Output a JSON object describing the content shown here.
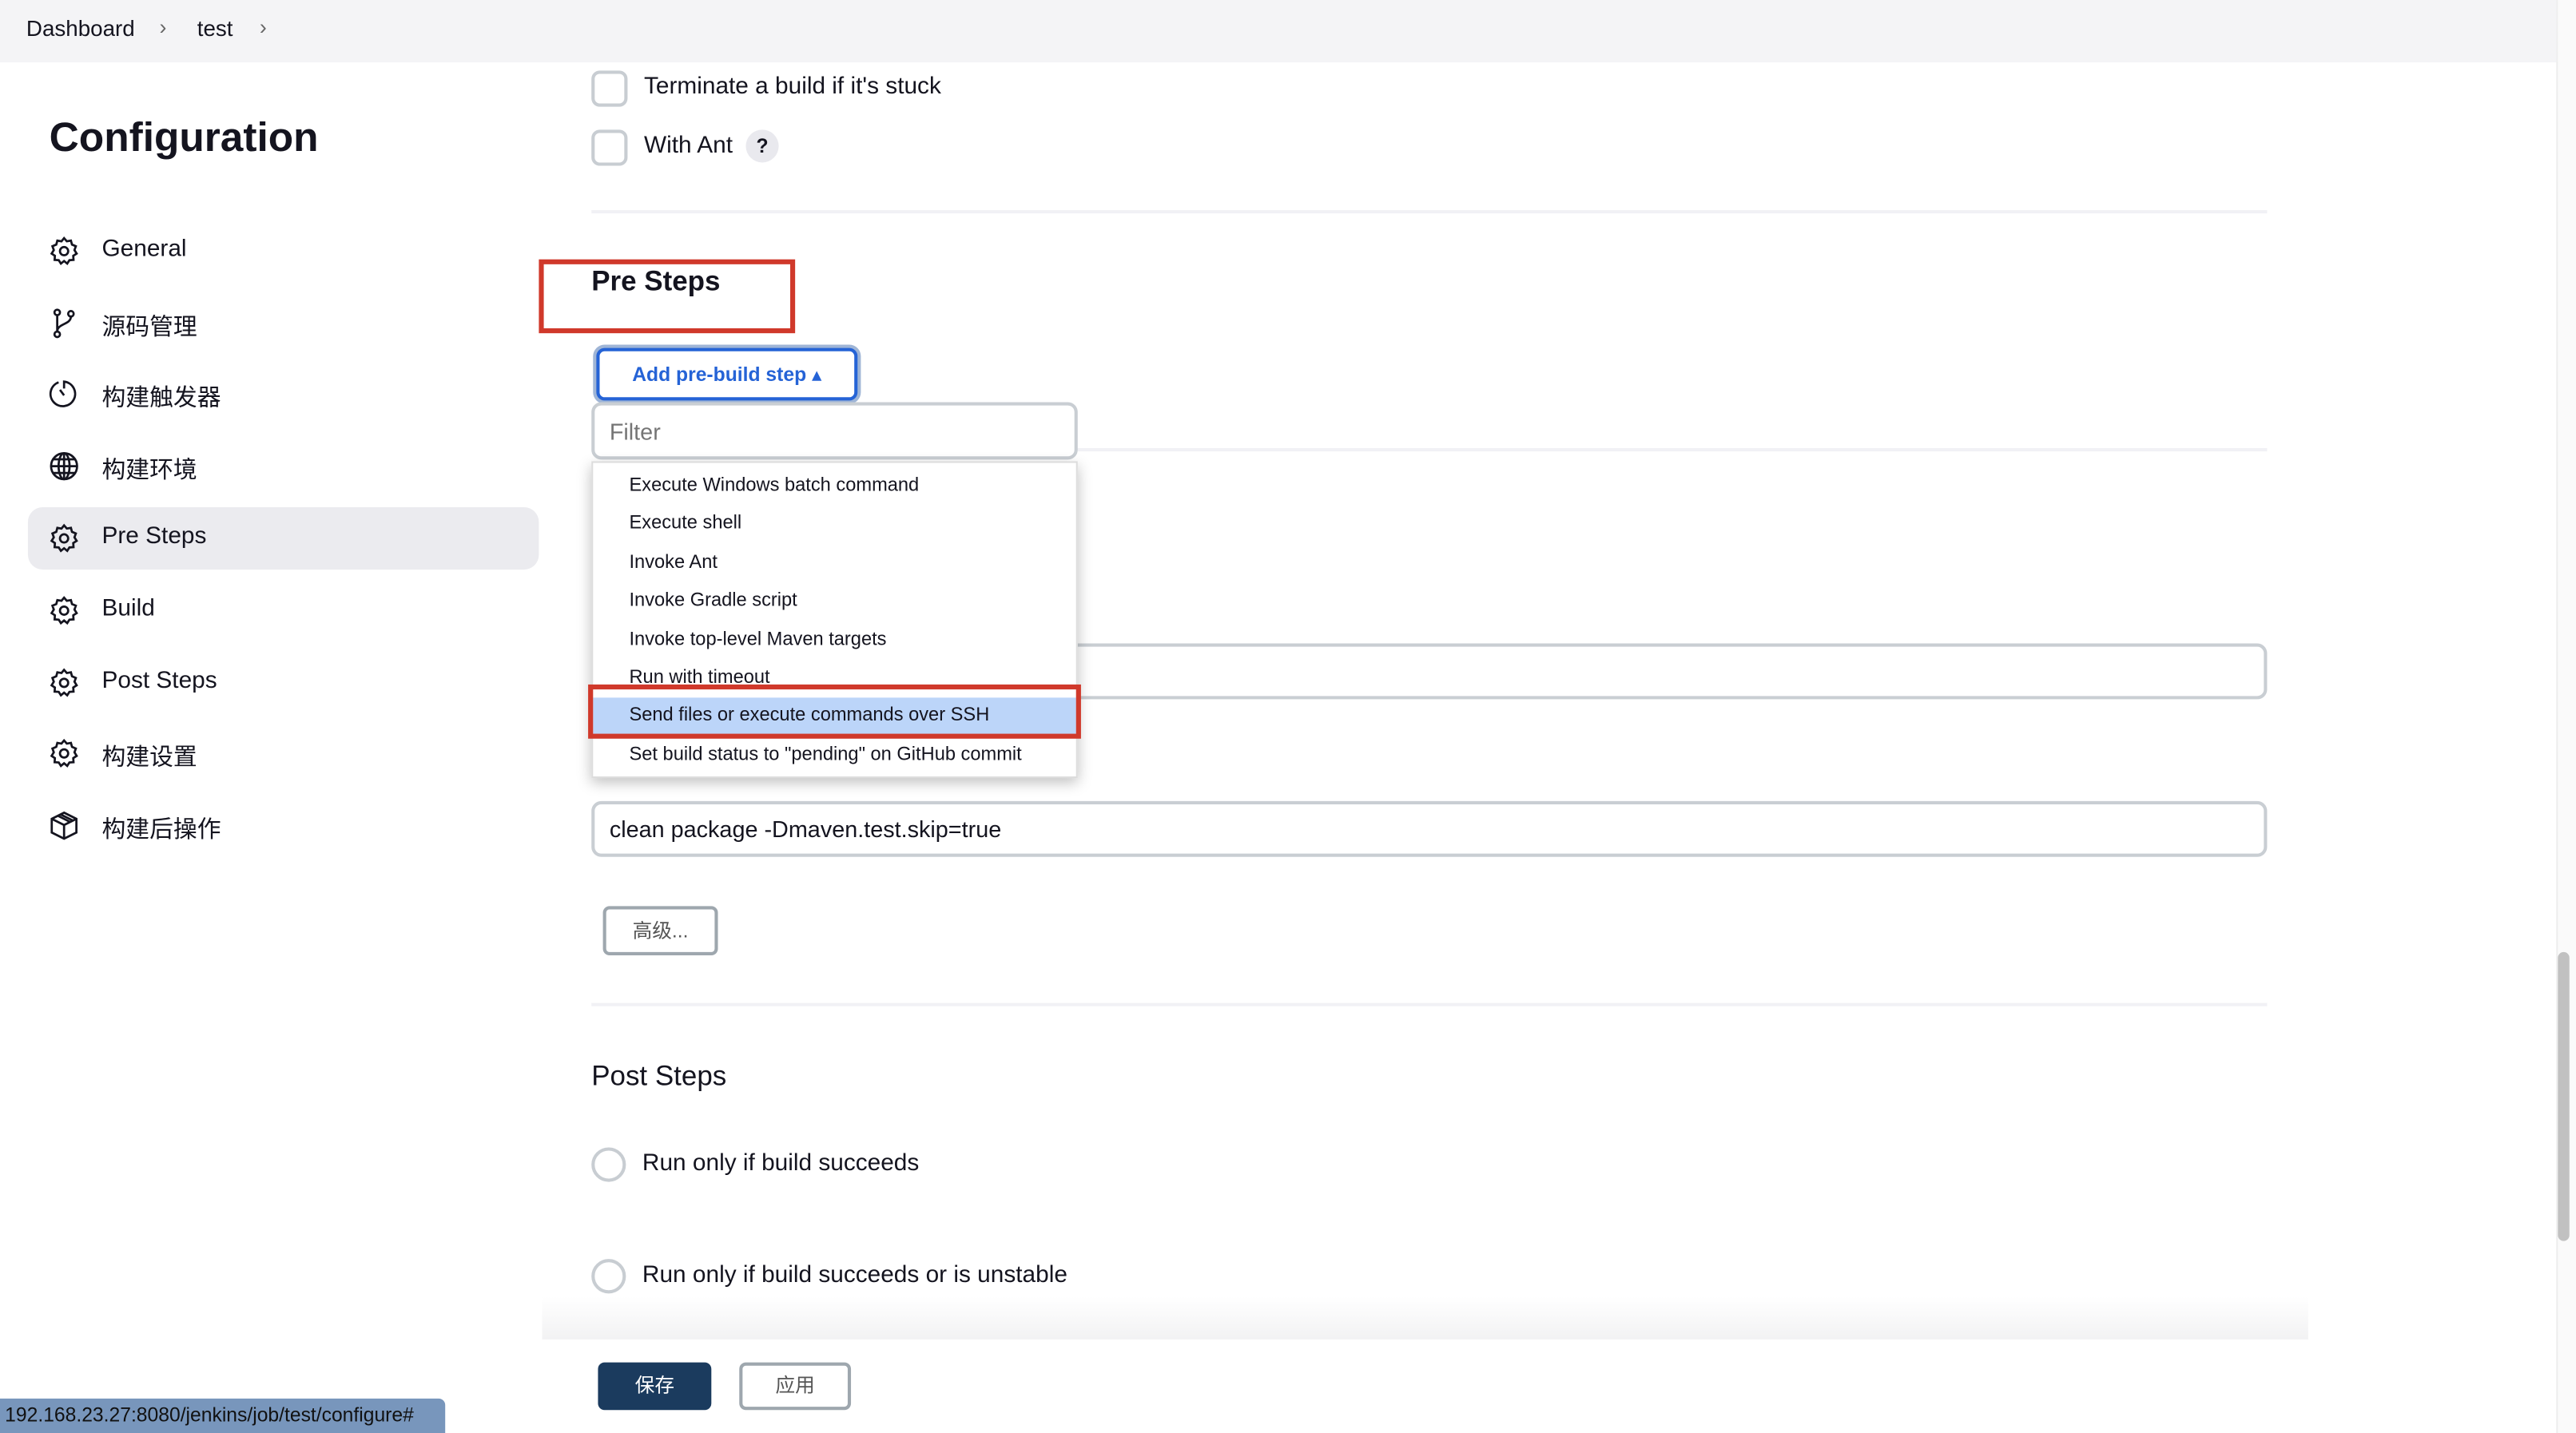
{
  "breadcrumb": {
    "items": [
      "Dashboard",
      "test"
    ]
  },
  "sidebar": {
    "title": "Configuration",
    "items": [
      {
        "label": "General",
        "icon": "gear-icon"
      },
      {
        "label": "源码管理",
        "icon": "branch-icon"
      },
      {
        "label": "构建触发器",
        "icon": "clock-icon"
      },
      {
        "label": "构建环境",
        "icon": "globe-icon"
      },
      {
        "label": "Pre Steps",
        "icon": "gear-icon",
        "active": true
      },
      {
        "label": "Build",
        "icon": "gear-icon"
      },
      {
        "label": "Post Steps",
        "icon": "gear-icon"
      },
      {
        "label": "构建设置",
        "icon": "gear-icon"
      },
      {
        "label": "构建后操作",
        "icon": "package-icon"
      }
    ]
  },
  "main": {
    "options": [
      {
        "label": "Terminate a build if it's stuck",
        "checked": false
      },
      {
        "label": "With Ant",
        "checked": false,
        "help": "?"
      }
    ],
    "pre_steps": {
      "title": "Pre Steps",
      "add_button": "Add pre-build step ▴",
      "filter_placeholder": "Filter",
      "menu_items": [
        "Execute Windows batch command",
        "Execute shell",
        "Invoke Ant",
        "Invoke Gradle script",
        "Invoke top-level Maven targets",
        "Run with timeout",
        "Send files or execute commands over SSH",
        "Set build status to \"pending\" on GitHub commit"
      ],
      "highlighted_item": "Send files or execute commands over SSH"
    },
    "goals_value": "clean package -Dmaven.test.skip=true",
    "advanced_button": "高级...",
    "post_steps": {
      "title": "Post Steps",
      "radios": [
        "Run only if build succeeds",
        "Run only if build succeeds or is unstable"
      ]
    },
    "save_button": "保存",
    "apply_button": "应用"
  },
  "status_url": "192.168.23.27:8080/jenkins/job/test/configure#",
  "colors": {
    "accent": "#2563d6",
    "highlight": "#bcd5f9",
    "annotation": "#d0392b",
    "save": "#1b3b5e"
  }
}
